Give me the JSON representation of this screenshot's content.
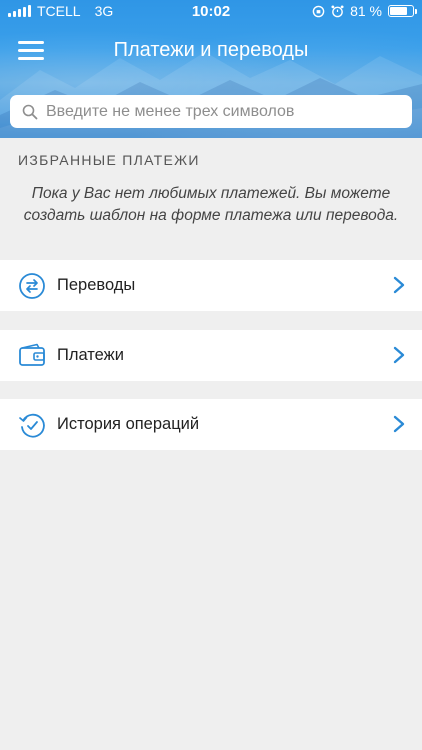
{
  "status_bar": {
    "carrier": "TCELL",
    "network": "3G",
    "time": "10:02",
    "battery_percent": "81 %",
    "battery_level": 0.81
  },
  "nav": {
    "title": "Платежи и переводы",
    "menu_icon": "hamburger-menu-icon"
  },
  "search": {
    "placeholder": "Введите не менее трех символов",
    "value": ""
  },
  "favorites": {
    "title": "ИЗБРАННЫЕ ПЛАТЕЖИ",
    "empty_message": "Пока у Вас нет любимых платежей. Вы можете создать шаблон на форме платежа или перевода."
  },
  "menu_items": [
    {
      "label": "Переводы",
      "icon": "transfer-arrows-icon"
    },
    {
      "label": "Платежи",
      "icon": "wallet-icon"
    },
    {
      "label": "История операций",
      "icon": "history-clock-icon"
    }
  ],
  "colors": {
    "accent": "#2a8ad6",
    "header": "#3a9fea",
    "background": "#efefef"
  }
}
